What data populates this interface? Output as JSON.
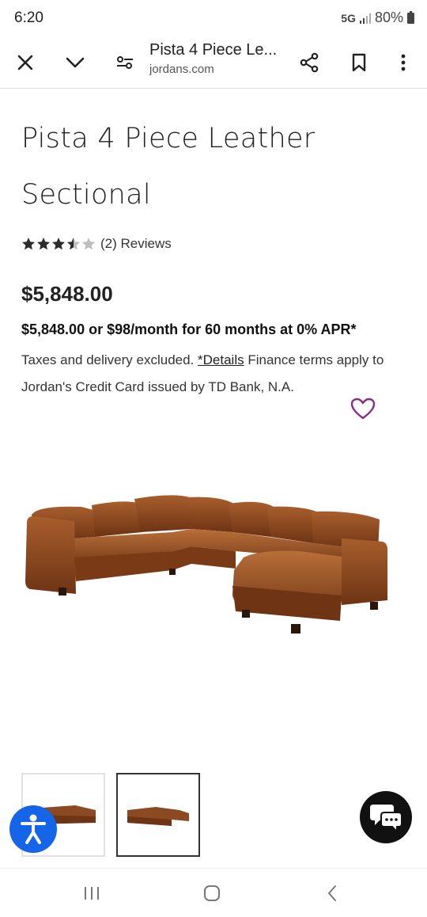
{
  "status_bar": {
    "time": "6:20",
    "network": "5G",
    "battery": "80%"
  },
  "toolbar": {
    "title": "Pista 4 Piece Le...",
    "domain": "jordans.com",
    "icons": [
      "close-icon",
      "chevron-down-icon",
      "page-settings-icon",
      "share-icon",
      "bookmark-icon",
      "more-vertical-icon"
    ]
  },
  "product": {
    "title": "Pista 4 Piece Leather Sectional",
    "rating": 3.5,
    "rating_max": 5,
    "reviews_text": "(2) Reviews",
    "price": "$5,848.00",
    "finance_offer": "$5,848.00 or $98/month for 60 months at 0% APR*",
    "terms_prefix": "Taxes and delivery excluded. ",
    "terms_link": "*Details",
    "terms_suffix": " Finance terms apply to Jordan's Credit Card issued by TD Bank, N.A.",
    "selected_thumbnail": 2
  },
  "colors": {
    "heart": "#8a2a8f",
    "accessibility_button": "#1565e8",
    "chat_button": "#111111",
    "leather": "#8b4a22"
  }
}
